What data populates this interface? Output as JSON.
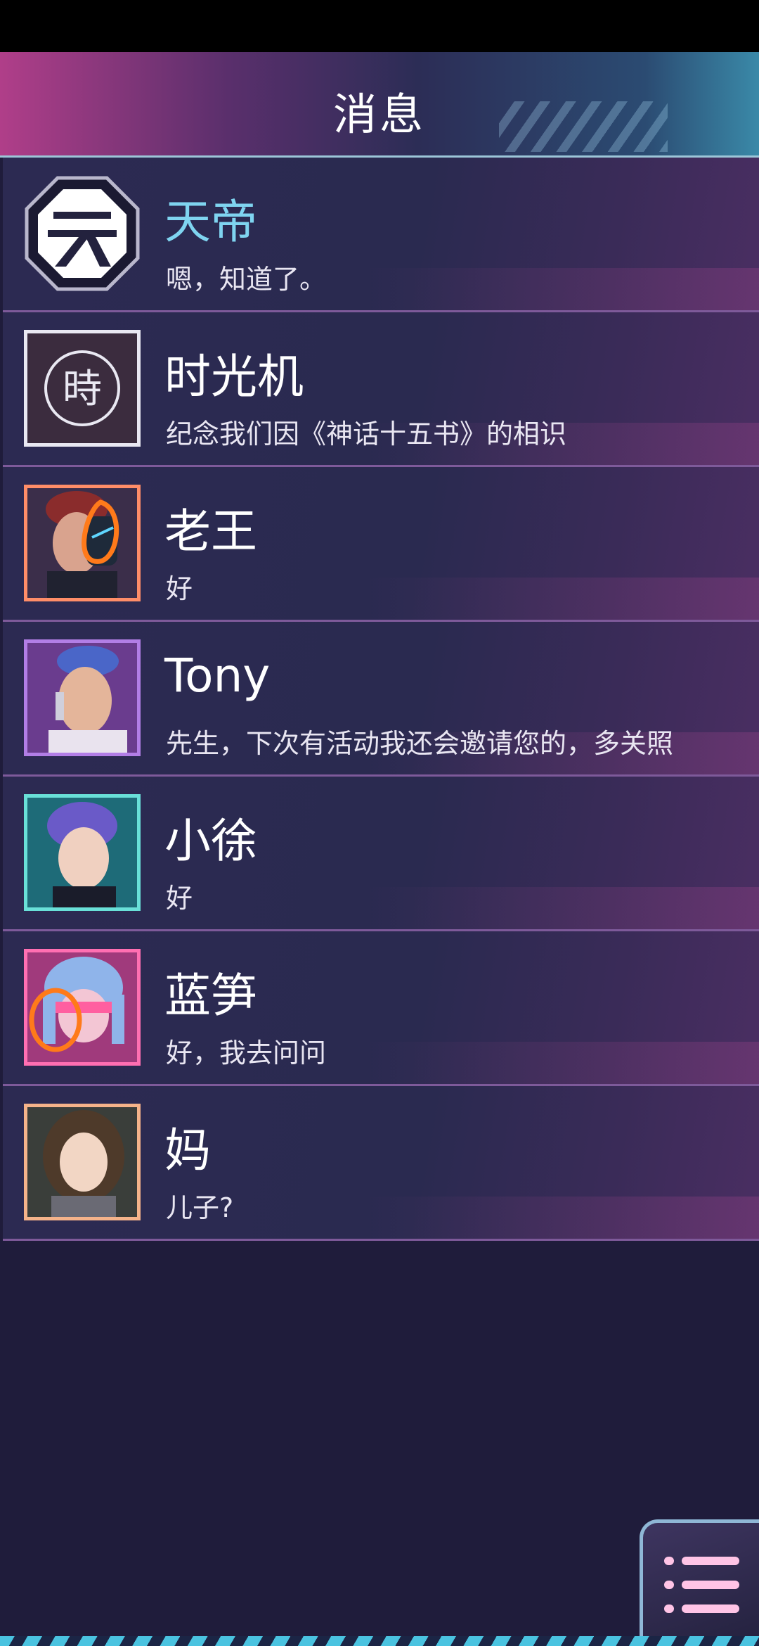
{
  "header": {
    "title": "消息"
  },
  "conversations": [
    {
      "name": "天帝",
      "message": "嗯，知道了。",
      "avatar_icon": "tian-emblem-icon",
      "avatar_glyph": "天",
      "name_color": "#7fd4f0"
    },
    {
      "name": "时光机",
      "message": "纪念我们因《神话十五书》的相识",
      "avatar_icon": "time-machine-seal-icon",
      "avatar_glyph": "時"
    },
    {
      "name": "老王",
      "message": "好",
      "avatar_icon": "man-avatar-icon"
    },
    {
      "name": "Tony",
      "message": "先生，下次有活动我还会邀请您的，多关照",
      "avatar_icon": "man-avatar-icon"
    },
    {
      "name": "小徐",
      "message": "好",
      "avatar_icon": "man-avatar-icon"
    },
    {
      "name": "蓝笋",
      "message": "好，我去问问",
      "avatar_icon": "woman-avatar-icon"
    },
    {
      "name": "妈",
      "message": "儿子?",
      "avatar_icon": "woman-avatar-icon"
    }
  ],
  "menu_button": {
    "icon": "list-menu-icon"
  },
  "colors": {
    "accent_cyan": "#7fd4f0",
    "row_divider": "#7e5a9a",
    "annotation_orange": "#ff7a1a"
  }
}
